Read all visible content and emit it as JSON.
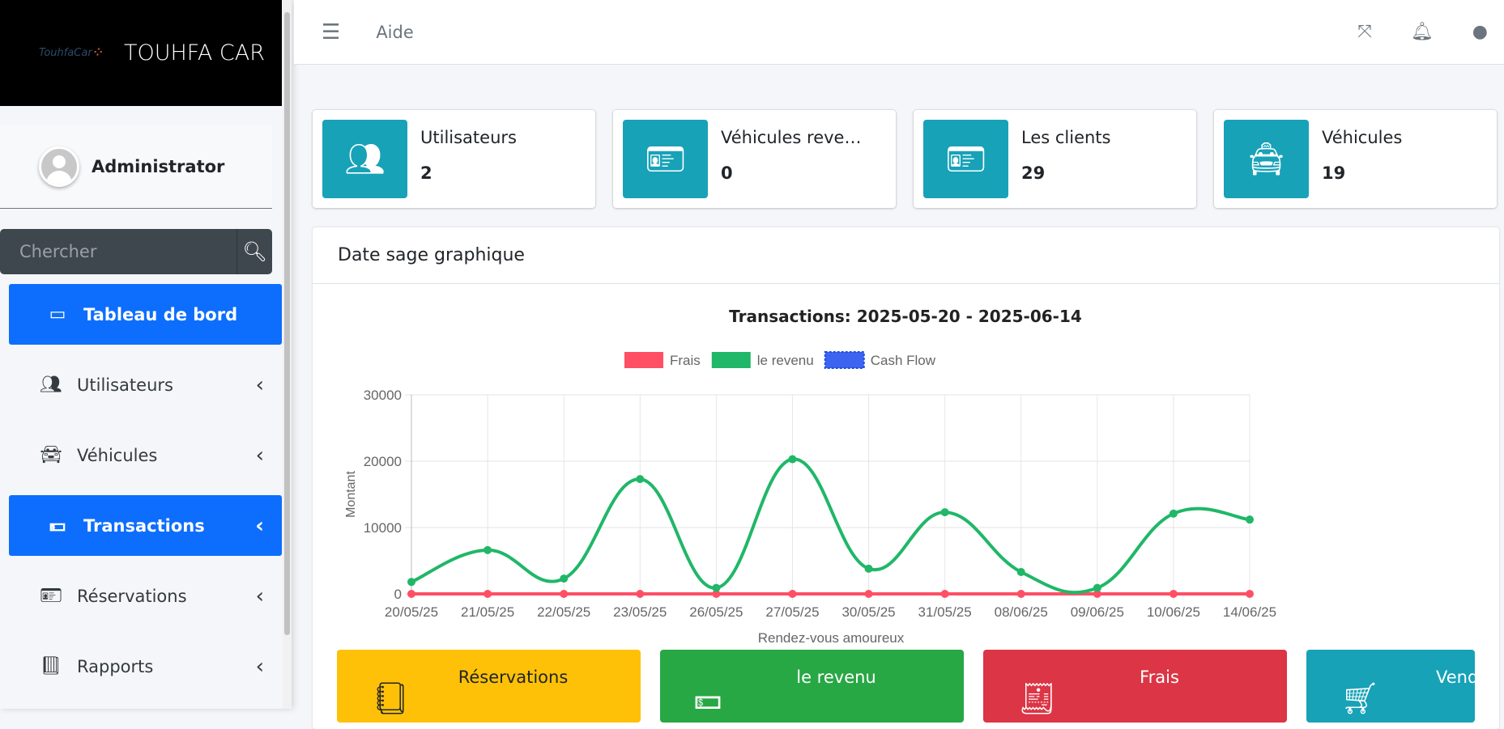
{
  "brand": {
    "name": "TOUHFA CAR",
    "logo_text": "TouhfaCar"
  },
  "user": {
    "name": "Administrator"
  },
  "search": {
    "placeholder": "Chercher"
  },
  "nav": [
    {
      "label": "Tableau de bord",
      "icon": "dashboard-icon",
      "active": true
    },
    {
      "label": "Utilisateurs",
      "icon": "users-icon"
    },
    {
      "label": "Véhicules",
      "icon": "car-icon"
    },
    {
      "label": "Transactions",
      "icon": "money-icon",
      "active": true
    },
    {
      "label": "Réservations",
      "icon": "id-card-icon"
    },
    {
      "label": "Rapports",
      "icon": "book-icon"
    }
  ],
  "topbar": {
    "help": "Aide"
  },
  "cards": [
    {
      "label": "Utilisateurs",
      "value": "2",
      "icon": "users-icon"
    },
    {
      "label": "Véhicules revenus",
      "value": "0",
      "icon": "vehicle-card-icon"
    },
    {
      "label": "Les clients",
      "value": "29",
      "icon": "id-card-icon"
    },
    {
      "label": "Véhicules",
      "value": "19",
      "icon": "taxi-icon"
    }
  ],
  "panel": {
    "title": "Date sage graphique"
  },
  "chart_data": {
    "type": "line",
    "title": "Transactions: 2025-05-20 - 2025-06-14",
    "xlabel": "Rendez-vous amoureux",
    "ylabel": "Montant",
    "ylim": [
      0,
      30000
    ],
    "yticks": [
      0,
      10000,
      20000,
      30000
    ],
    "categories": [
      "20/05/25",
      "21/05/25",
      "22/05/25",
      "23/05/25",
      "26/05/25",
      "27/05/25",
      "30/05/25",
      "31/05/25",
      "08/06/25",
      "09/06/25",
      "10/06/25",
      "14/06/25"
    ],
    "series": [
      {
        "name": "Frais",
        "color": "#ff4f64",
        "values": [
          0,
          0,
          0,
          0,
          0,
          0,
          0,
          0,
          0,
          0,
          0,
          0
        ]
      },
      {
        "name": "le revenu",
        "color": "#20b768",
        "values": [
          1800,
          6600,
          2300,
          17300,
          900,
          20300,
          3800,
          12300,
          3300,
          900,
          12100,
          11200
        ]
      },
      {
        "name": "Cash Flow",
        "color": "#3c64f0",
        "values": []
      }
    ],
    "legend": "top",
    "grid": true
  },
  "stats": [
    {
      "label": "Réservations",
      "color": "#ffc107",
      "text": "#212529"
    },
    {
      "label": "le revenu",
      "color": "#28a745",
      "text": "#fff"
    },
    {
      "label": "Frais",
      "color": "#dc3545",
      "text": "#fff"
    },
    {
      "label": "Vendeur",
      "color": "#17a2b8",
      "text": "#fff"
    }
  ]
}
